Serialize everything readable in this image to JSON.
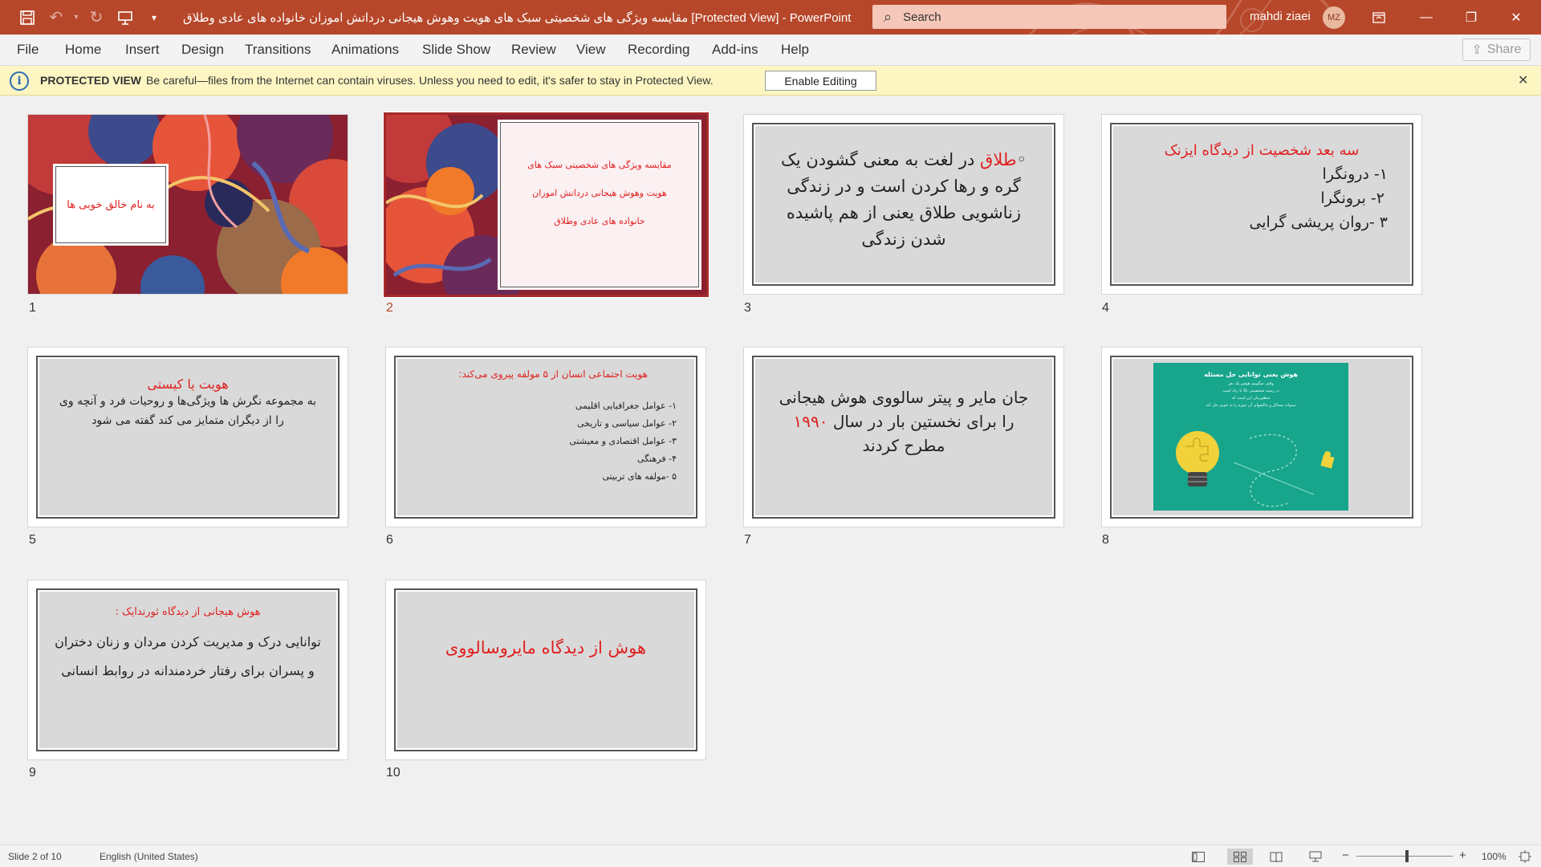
{
  "titlebar": {
    "title": "مقایسه ویژگی های شخصیتی سبک های هویت وهوش هیجانی درداتش اموزان خانواده های عادی وطلاق  [Protected View]  -  PowerPoint",
    "search_placeholder": "Search",
    "user_name": "mahdi ziaei",
    "user_initials": "MZ"
  },
  "ribbon": {
    "tabs": [
      "File",
      "Home",
      "Insert",
      "Design",
      "Transitions",
      "Animations",
      "Slide Show",
      "Review",
      "View",
      "Recording",
      "Add-ins",
      "Help"
    ],
    "share_label": "Share"
  },
  "protected_view": {
    "title": "PROTECTED VIEW",
    "message": "Be careful—files from the Internet can contain viruses. Unless you need to edit, it's safer to stay in Protected View.",
    "enable_label": "Enable Editing"
  },
  "slides": {
    "s1": {
      "num": "1",
      "text": "به نام خالق خوبی ها"
    },
    "s2": {
      "num": "2",
      "line1": "مقایسه ویژگی های شخصیتی سبک های",
      "line2": "هویت وهوش هیجانی درداتش اموزان",
      "line3": "خانواده های عادی وطلاق"
    },
    "s3": {
      "num": "3",
      "red": "طلاق",
      "rest": " در لغت به معنی گشودن یک گره و رها کردن است و در زندگی زناشویی طلاق یعنی از هم پاشیده شدن زندگی"
    },
    "s4": {
      "num": "4",
      "title": "سه بعد شخصیت از دیدگاه ایزنک",
      "items": [
        "۱- درونگرا",
        "۲- برونگرا",
        "۳ -روان پریشی گرایی"
      ]
    },
    "s5": {
      "num": "5",
      "title": "هویت یا کیستی",
      "body": "به مجموعه نگرش ها ویژگی‌ها و روحیات فرد و آنچه وی را از دیگران متمایز می کند گفته می شود"
    },
    "s6": {
      "num": "6",
      "title": "هویت اجتماعی انسان از ۵ مولفه پیروی می‌کند:",
      "items": [
        "۱- عوامل جغرافیایی اقلیمی",
        "۲- عوامل سیاسی و تاریخی",
        "۳- عوامل اقتصادی و معیشتی",
        "۴- فرهنگی",
        "۵ -مولفه های تربیتی"
      ]
    },
    "s7": {
      "num": "7",
      "line1": "جان مایر و پیتر سالووی هوش هیجانی",
      "line2a": "را برای نخستین بار در سال",
      "year": "۱۹۹۰",
      "line3": "مطرح کردند"
    },
    "s8": {
      "num": "8",
      "img_title": "هوش یعنی توانایی حل مسئله",
      "img_lines": [
        "وقتی میگوییم هوش یک نفر",
        "در زمینه شخصیتی بالا یا زیاد است",
        "منظورمان این است که",
        "میتواند مسائل و چالشهای آن حوزه را به خوبی حل کند"
      ]
    },
    "s9": {
      "num": "9",
      "title": "هوش هیجانی از دیدگاه ثورندایک :",
      "body": "توانایی درک و مدیریت کردن مردان و زنان دختران و پسران برای رفتار خردمندانه در روابط انسانی"
    },
    "s10": {
      "num": "10",
      "title": "هوش از دیدگاه مایروسالووی"
    }
  },
  "statusbar": {
    "slide_info": "Slide 2 of 10",
    "language": "English (United States)",
    "zoom": "100%"
  },
  "colors": {
    "titlebar": "#b7472a",
    "accent_red": "#e02020",
    "teal": "#17a58c"
  }
}
